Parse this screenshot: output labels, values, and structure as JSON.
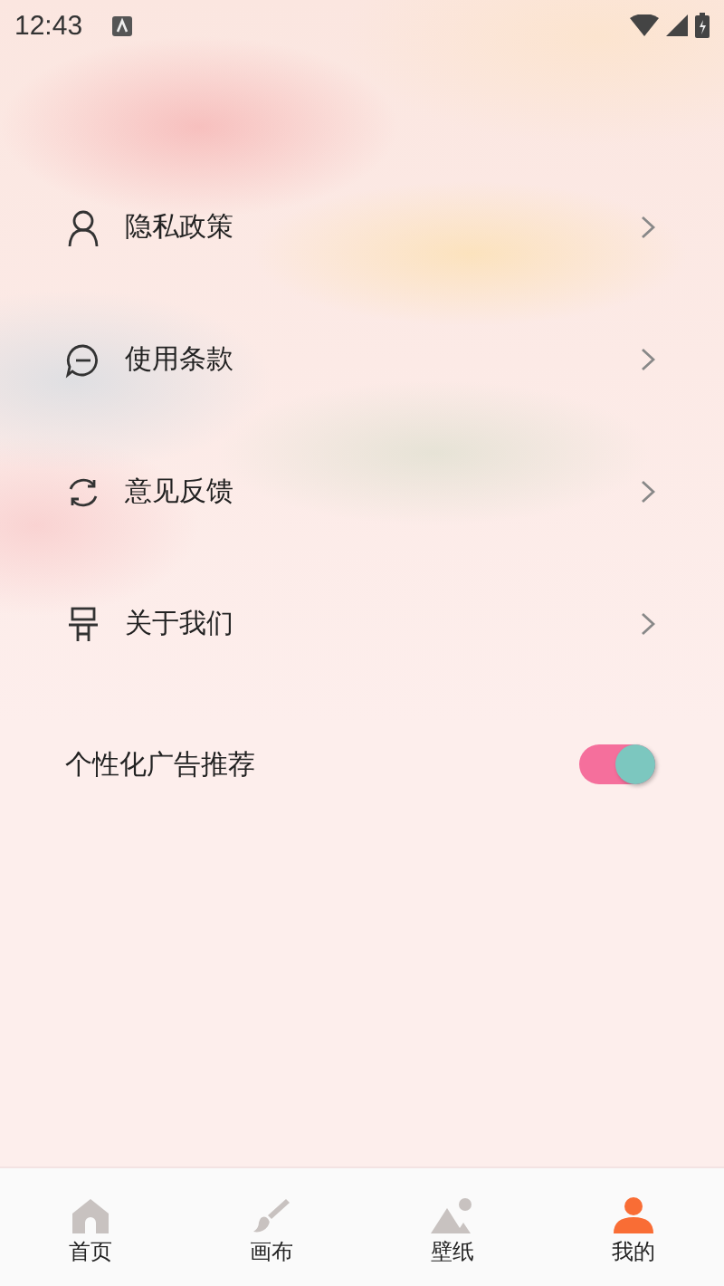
{
  "status_bar": {
    "time": "12:43"
  },
  "menu": [
    {
      "label": "隐私政策"
    },
    {
      "label": "使用条款"
    },
    {
      "label": "意见反馈"
    },
    {
      "label": "关于我们"
    }
  ],
  "setting": {
    "label": "个性化广告推荐",
    "on": true
  },
  "bottom_nav": [
    {
      "label": "首页",
      "selected": false
    },
    {
      "label": "画布",
      "selected": false
    },
    {
      "label": "壁纸",
      "selected": false
    },
    {
      "label": "我的",
      "selected": true
    }
  ]
}
